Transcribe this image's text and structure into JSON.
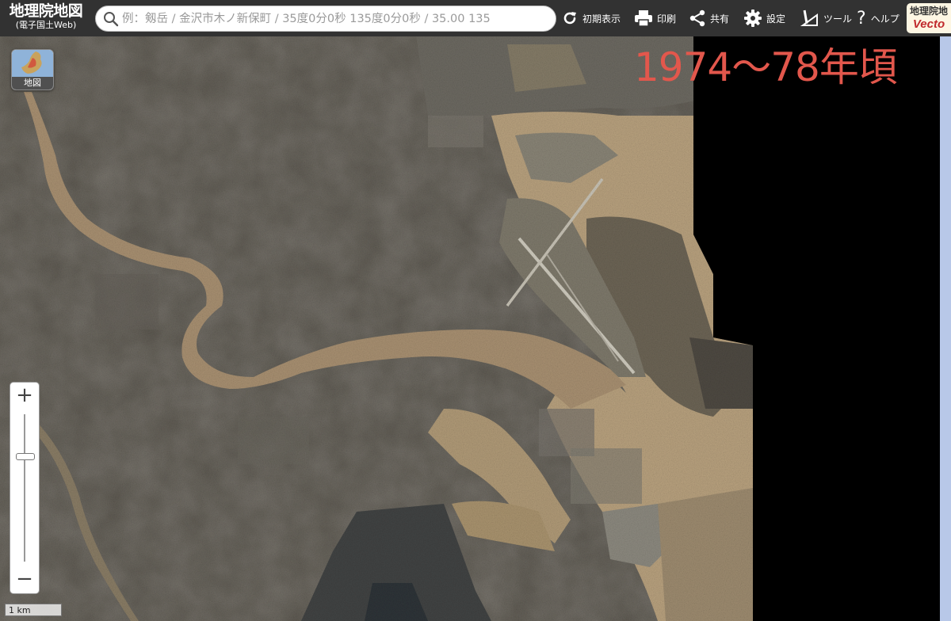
{
  "header": {
    "title": "地理院地図",
    "subtitle": "(電子国土Web)",
    "search_placeholder": "例：剱岳 / 金沢市木ノ新保町 / 35度0分0秒 135度0分0秒 / 35.00 135",
    "buttons": {
      "home": "初期表示",
      "print": "印刷",
      "share": "共有",
      "settings": "設定",
      "tools": "ツール",
      "help": "ヘルプ"
    },
    "help_glyph": "?",
    "vector_badge": {
      "line1": "地理院地",
      "line2": "Vecto"
    }
  },
  "map": {
    "era_label": "1974〜78年頃",
    "layer_button_label": "地図",
    "zoom_in": "+",
    "zoom_out": "−",
    "scale_label": "1 km",
    "colors": {
      "era_label": "#e2574c",
      "water": "#b59c78",
      "land": "#5a5650"
    }
  }
}
